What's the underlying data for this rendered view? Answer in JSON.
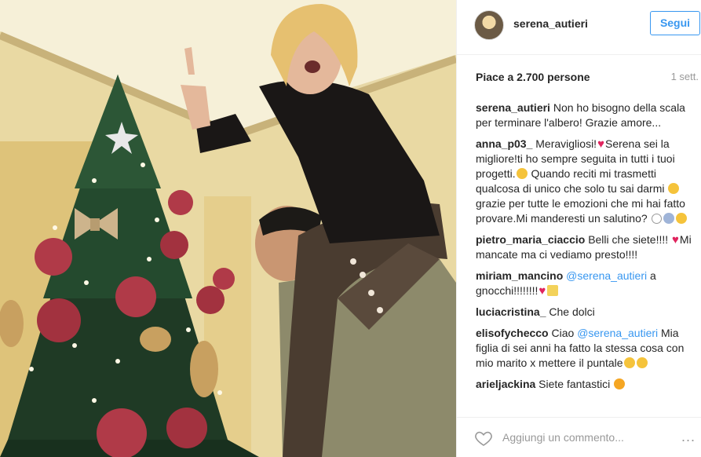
{
  "post": {
    "username": "serena_autieri",
    "follow_label": "Segui",
    "likes": "Piace a 2.700 persone",
    "time_ago": "1 sett."
  },
  "comments": [
    {
      "user": "serena_autieri",
      "text": "Non ho bisogno della scala per terminare l'albero! Grazie amore..."
    },
    {
      "user": "anna_p03_",
      "text": "Meravigliosi!",
      "text2": "Serena sei la migliore!ti ho sempre seguita in tutti i tuoi progetti.",
      "text3": "Quando reciti mi trasmetti qualcosa di unico che solo tu sai darmi",
      "text4": "grazie per tutte le emozioni che mi hai fatto provare.Mi manderesti un salutino?"
    },
    {
      "user": "pietro_maria_ciaccio",
      "text": "Belli che siete!!!!",
      "text2": "Mi mancate ma ci vediamo presto!!!!"
    },
    {
      "user": "miriam_mancino",
      "mention": "@serena_autieri",
      "text": "a gnocchi!!!!!!!!"
    },
    {
      "user": "luciacristina_",
      "text": "Che dolci"
    },
    {
      "user": "elisofychecco",
      "text": "Ciao",
      "mention": "@serena_autieri",
      "text2": "Mia figlia di sei anni ha fatto la stessa cosa con mio marito x mettere il puntale"
    },
    {
      "user": "arieljackina",
      "text": "Siete fantastici"
    }
  ],
  "footer": {
    "placeholder": "Aggiungi un commento...",
    "more": "..."
  },
  "icons": {
    "like": "heart-outline-icon",
    "more": "more-dots-icon"
  },
  "colors": {
    "accent": "#3897f0",
    "heart": "#e0245e",
    "muted": "#999999"
  }
}
